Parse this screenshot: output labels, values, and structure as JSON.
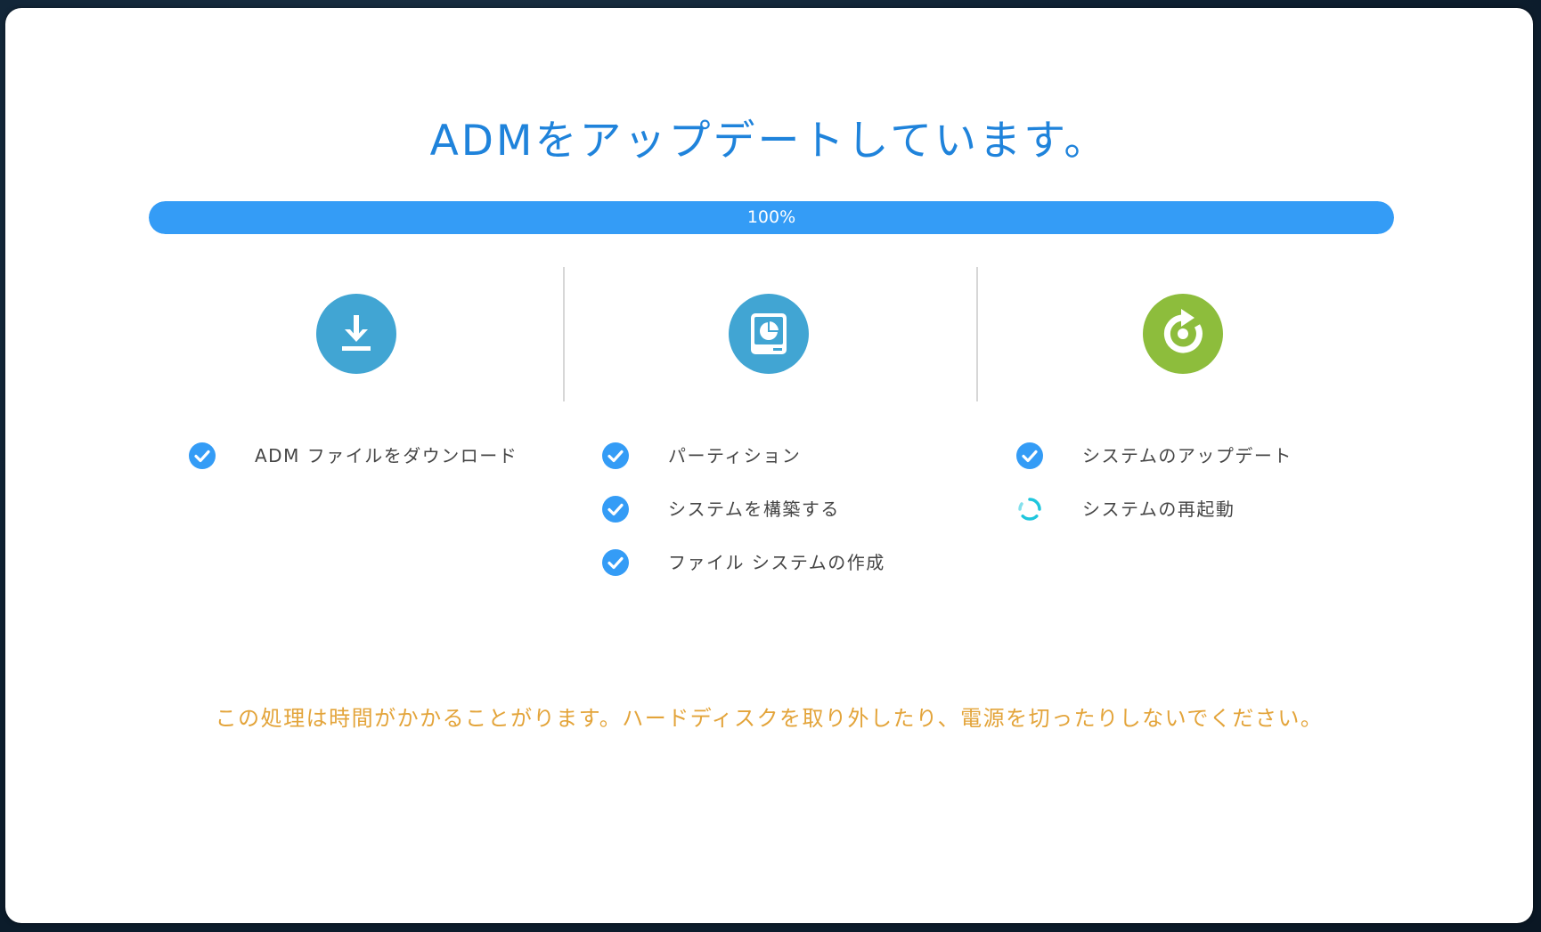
{
  "title": "ADMをアップデートしています。",
  "progress": {
    "percent": 100,
    "label": "100%"
  },
  "colors": {
    "title": "#1f83db",
    "progress_fill": "#349cf6",
    "step_blue": "#41a5d3",
    "step_green": "#8dbd3c",
    "check": "#349cf6",
    "spinner": "#1fc6dd",
    "warning": "#e3a43a"
  },
  "steps": [
    {
      "icon": "download-icon",
      "items": [
        {
          "label": "ADM ファイルをダウンロード",
          "status": "done"
        }
      ]
    },
    {
      "icon": "hard-drive-icon",
      "items": [
        {
          "label": "パーティション",
          "status": "done"
        },
        {
          "label": "システムを構築する",
          "status": "done"
        },
        {
          "label": "ファイル システムの作成",
          "status": "done"
        }
      ]
    },
    {
      "icon": "restart-icon",
      "items": [
        {
          "label": "システムのアップデート",
          "status": "done"
        },
        {
          "label": "システムの再起動",
          "status": "in-progress"
        }
      ]
    }
  ],
  "warning": "この処理は時間がかかることがります。ハードディスクを取り外したり、電源を切ったりしないでください。"
}
